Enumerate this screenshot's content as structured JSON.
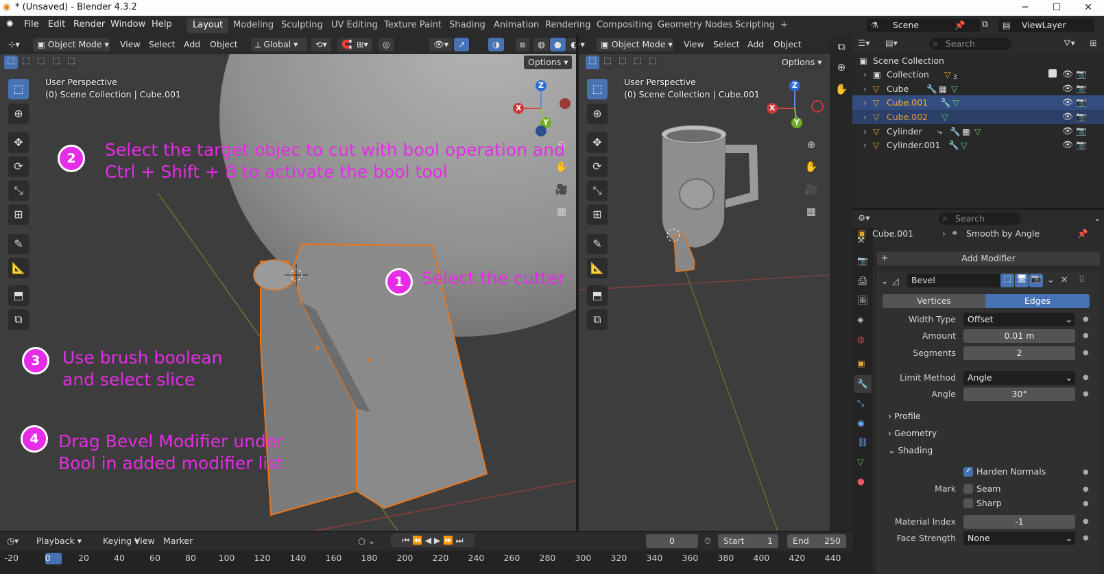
{
  "window": {
    "title": "* (Unsaved) - Blender 4.3.2",
    "minimize": "─",
    "maximize": "☐",
    "close": "✕"
  },
  "menu": [
    "File",
    "Edit",
    "Render",
    "Window",
    "Help"
  ],
  "workspaces": [
    "Layout",
    "Modeling",
    "Sculpting",
    "UV Editing",
    "Texture Paint",
    "Shading",
    "Animation",
    "Rendering",
    "Compositing",
    "Geometry Nodes",
    "Scripting",
    "+"
  ],
  "viewport_left": {
    "mode": "Object Mode",
    "menus": [
      "View",
      "Select",
      "Add",
      "Object"
    ],
    "transform": "Global",
    "options": "Options",
    "overlay_line1": "User Perspective",
    "overlay_line2": "(0) Scene Collection | Cube.001"
  },
  "viewport_right": {
    "mode": "Object Mode",
    "menus": [
      "View",
      "Select",
      "Add",
      "Object"
    ],
    "options": "Options",
    "overlay_line1": "User Perspective",
    "overlay_line2": "(0) Scene Collection | Cube.001"
  },
  "annotations": {
    "n1": "1",
    "t1": "Select the cutter",
    "n2": "2",
    "t2a": "Select the target objec to cut with bool operation and",
    "t2b": "Ctrl + Shift + B to activate the bool tool",
    "n3": "3",
    "t3a": "Use brush boolean",
    "t3b": "and select slice",
    "n4": "4",
    "t4a": "Drag Bevel Modifier under",
    "t4b": "Bool in added modifier list"
  },
  "gizmo": {
    "x": "X",
    "y": "Y",
    "z": "Z"
  },
  "scene": {
    "scene_name": "Scene",
    "view_layer": "ViewLayer",
    "search": "Search"
  },
  "outliner": {
    "root": "Scene Collection",
    "items": [
      {
        "name": "Collection",
        "count": "3"
      },
      {
        "name": "Cube"
      },
      {
        "name": "Cube.001"
      },
      {
        "name": "Cube.002"
      },
      {
        "name": "Cylinder"
      },
      {
        "name": "Cylinder.001"
      }
    ]
  },
  "properties": {
    "search": "Search",
    "object": "Cube.001",
    "modifier_breadcrumb": "Smooth by Angle",
    "add_modifier": "Add Modifier",
    "modifier_name": "Bevel",
    "affect_vertices": "Vertices",
    "affect_edges": "Edges",
    "width_type_label": "Width Type",
    "width_type": "Offset",
    "amount_label": "Amount",
    "amount": "0.01 m",
    "segments_label": "Segments",
    "segments": "2",
    "limit_method_label": "Limit Method",
    "limit_method": "Angle",
    "angle_label": "Angle",
    "angle": "30°",
    "profile": "Profile",
    "geometry": "Geometry",
    "shading": "Shading",
    "harden_normals": "Harden Normals",
    "mark_label": "Mark",
    "seam": "Seam",
    "sharp": "Sharp",
    "material_index_label": "Material Index",
    "material_index": "-1",
    "face_strength_label": "Face Strength",
    "face_strength": "None"
  },
  "timeline": {
    "menus": [
      "Playback",
      "Keying",
      "View",
      "Marker"
    ],
    "current_frame": "0",
    "start_label": "Start",
    "start": "1",
    "end_label": "End",
    "end": "250",
    "ticks": [
      "-20",
      "0",
      "20",
      "40",
      "60",
      "80",
      "100",
      "120",
      "140",
      "160",
      "180",
      "200",
      "220",
      "240",
      "260",
      "280",
      "300",
      "320",
      "340",
      "360",
      "380",
      "400",
      "420",
      "440"
    ]
  }
}
